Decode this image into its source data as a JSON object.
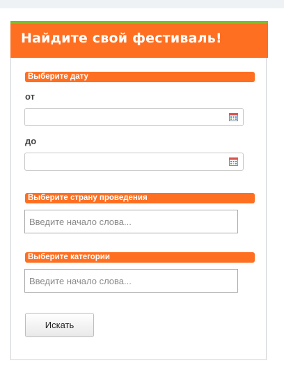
{
  "form": {
    "title": "Найдите свой фестиваль!",
    "date_section": {
      "header": "Выберите дату",
      "from_label": "от",
      "from_value": "",
      "to_label": "до",
      "to_value": "",
      "calendar_icon": "calendar-icon"
    },
    "country_section": {
      "header": "Выберите страну проведения",
      "placeholder": "Введите начало слова..."
    },
    "category_section": {
      "header": "Выберите категории",
      "placeholder": "Введите начало слова..."
    },
    "submit_label": "Искать"
  },
  "colors": {
    "accent": "#ff6f21",
    "top_stripe": "#7bbf2a",
    "border": "#cfd4d8"
  }
}
